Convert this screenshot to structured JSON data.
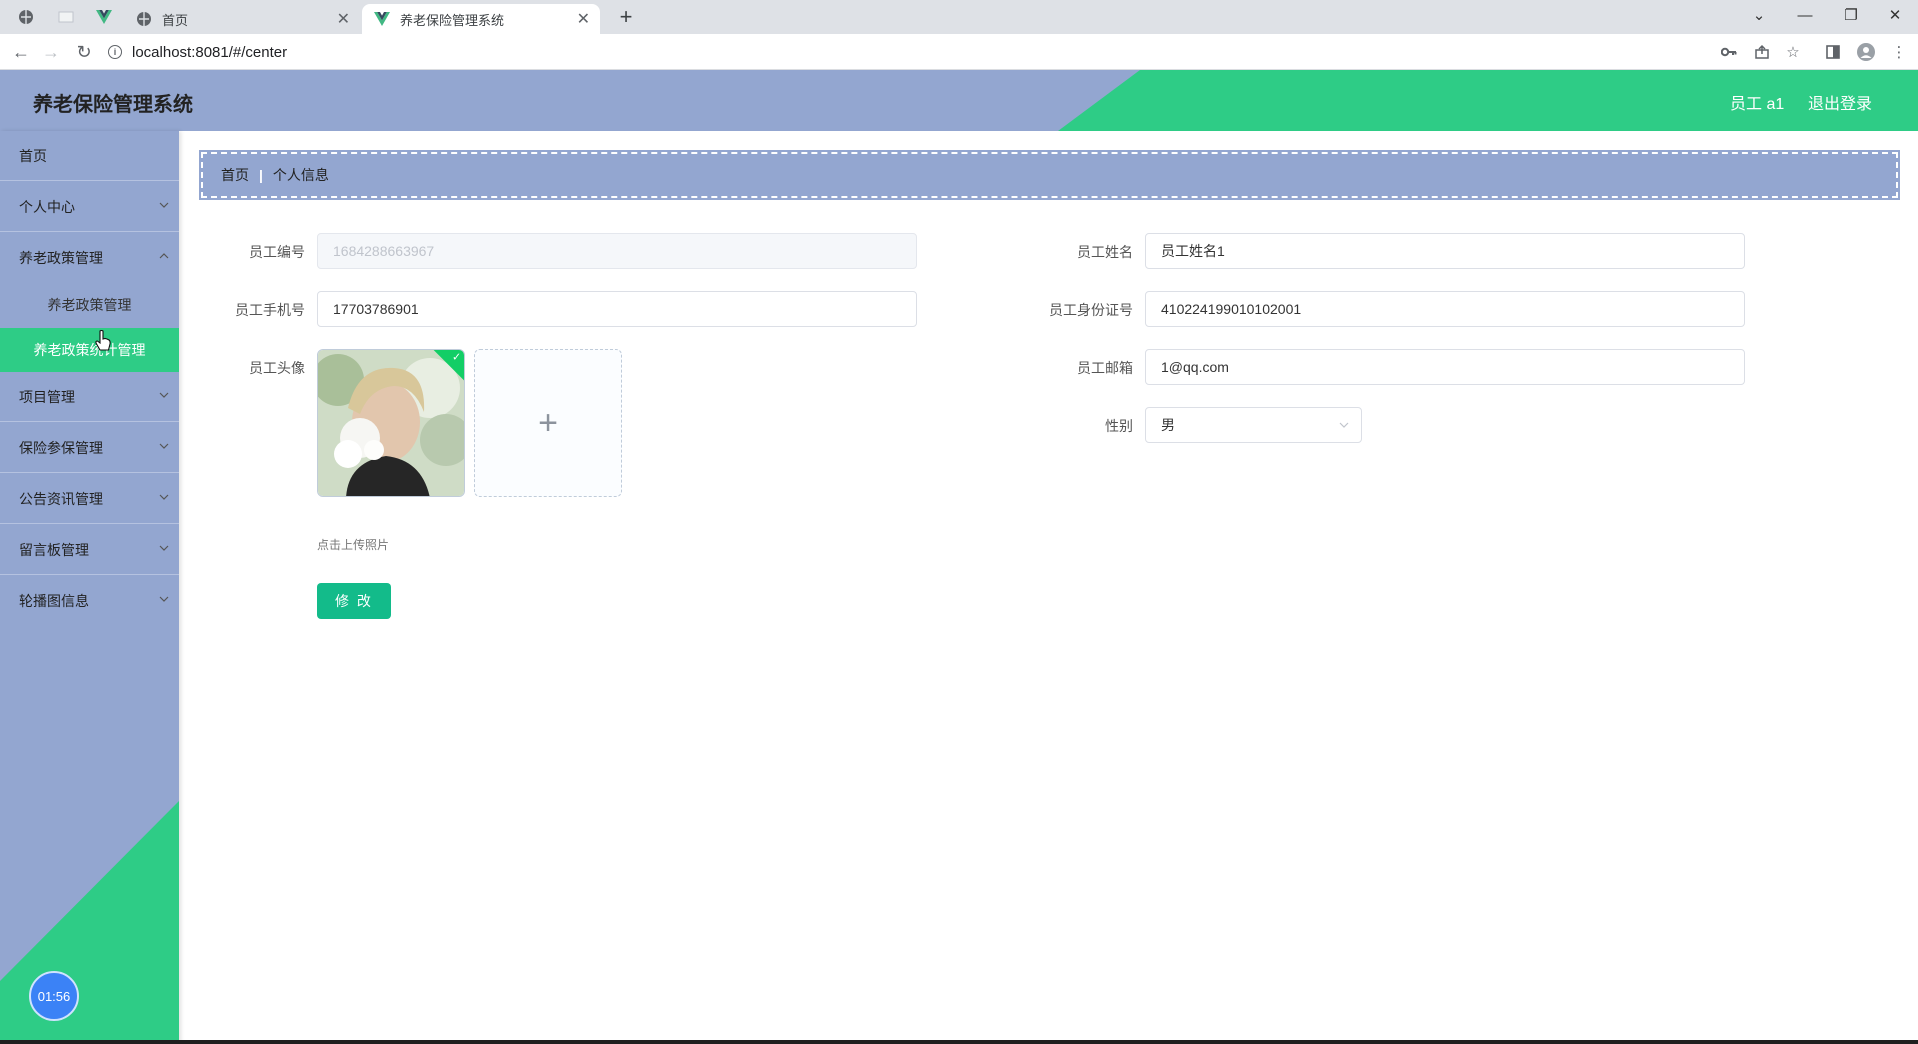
{
  "browser": {
    "tabs": [
      {
        "title": "首页",
        "active": false
      },
      {
        "title": "养老保险管理系统",
        "active": true
      }
    ],
    "url": "localhost:8081/#/center"
  },
  "header": {
    "title": "养老保险管理系统",
    "user": "员工 a1",
    "logout": "退出登录"
  },
  "sidebar": {
    "items": [
      {
        "label": "首页"
      },
      {
        "label": "个人中心"
      },
      {
        "label": "养老政策管理"
      },
      {
        "label": "项目管理"
      },
      {
        "label": "保险参保管理"
      },
      {
        "label": "公告资讯管理"
      },
      {
        "label": "留言板管理"
      },
      {
        "label": "轮播图信息"
      }
    ],
    "subitems": [
      {
        "label": "养老政策管理"
      },
      {
        "label": "养老政策统计管理"
      }
    ],
    "timer": "01:56"
  },
  "breadcrumb": {
    "home": "首页",
    "current": "个人信息"
  },
  "form": {
    "employee_no": {
      "label": "员工编号",
      "value": "1684288663967"
    },
    "employee_name": {
      "label": "员工姓名",
      "value": "员工姓名1"
    },
    "phone": {
      "label": "员工手机号",
      "value": "17703786901"
    },
    "id_card": {
      "label": "员工身份证号",
      "value": "410224199010102001"
    },
    "avatar": {
      "label": "员工头像",
      "tip": "点击上传照片"
    },
    "email": {
      "label": "员工邮箱",
      "value": "1@qq.com"
    },
    "gender": {
      "label": "性别",
      "value": "男"
    },
    "submit": "修 改"
  },
  "colors": {
    "sidebar": "#93a6d0",
    "accent_green": "#2ecc86",
    "button": "#13bb8a"
  }
}
